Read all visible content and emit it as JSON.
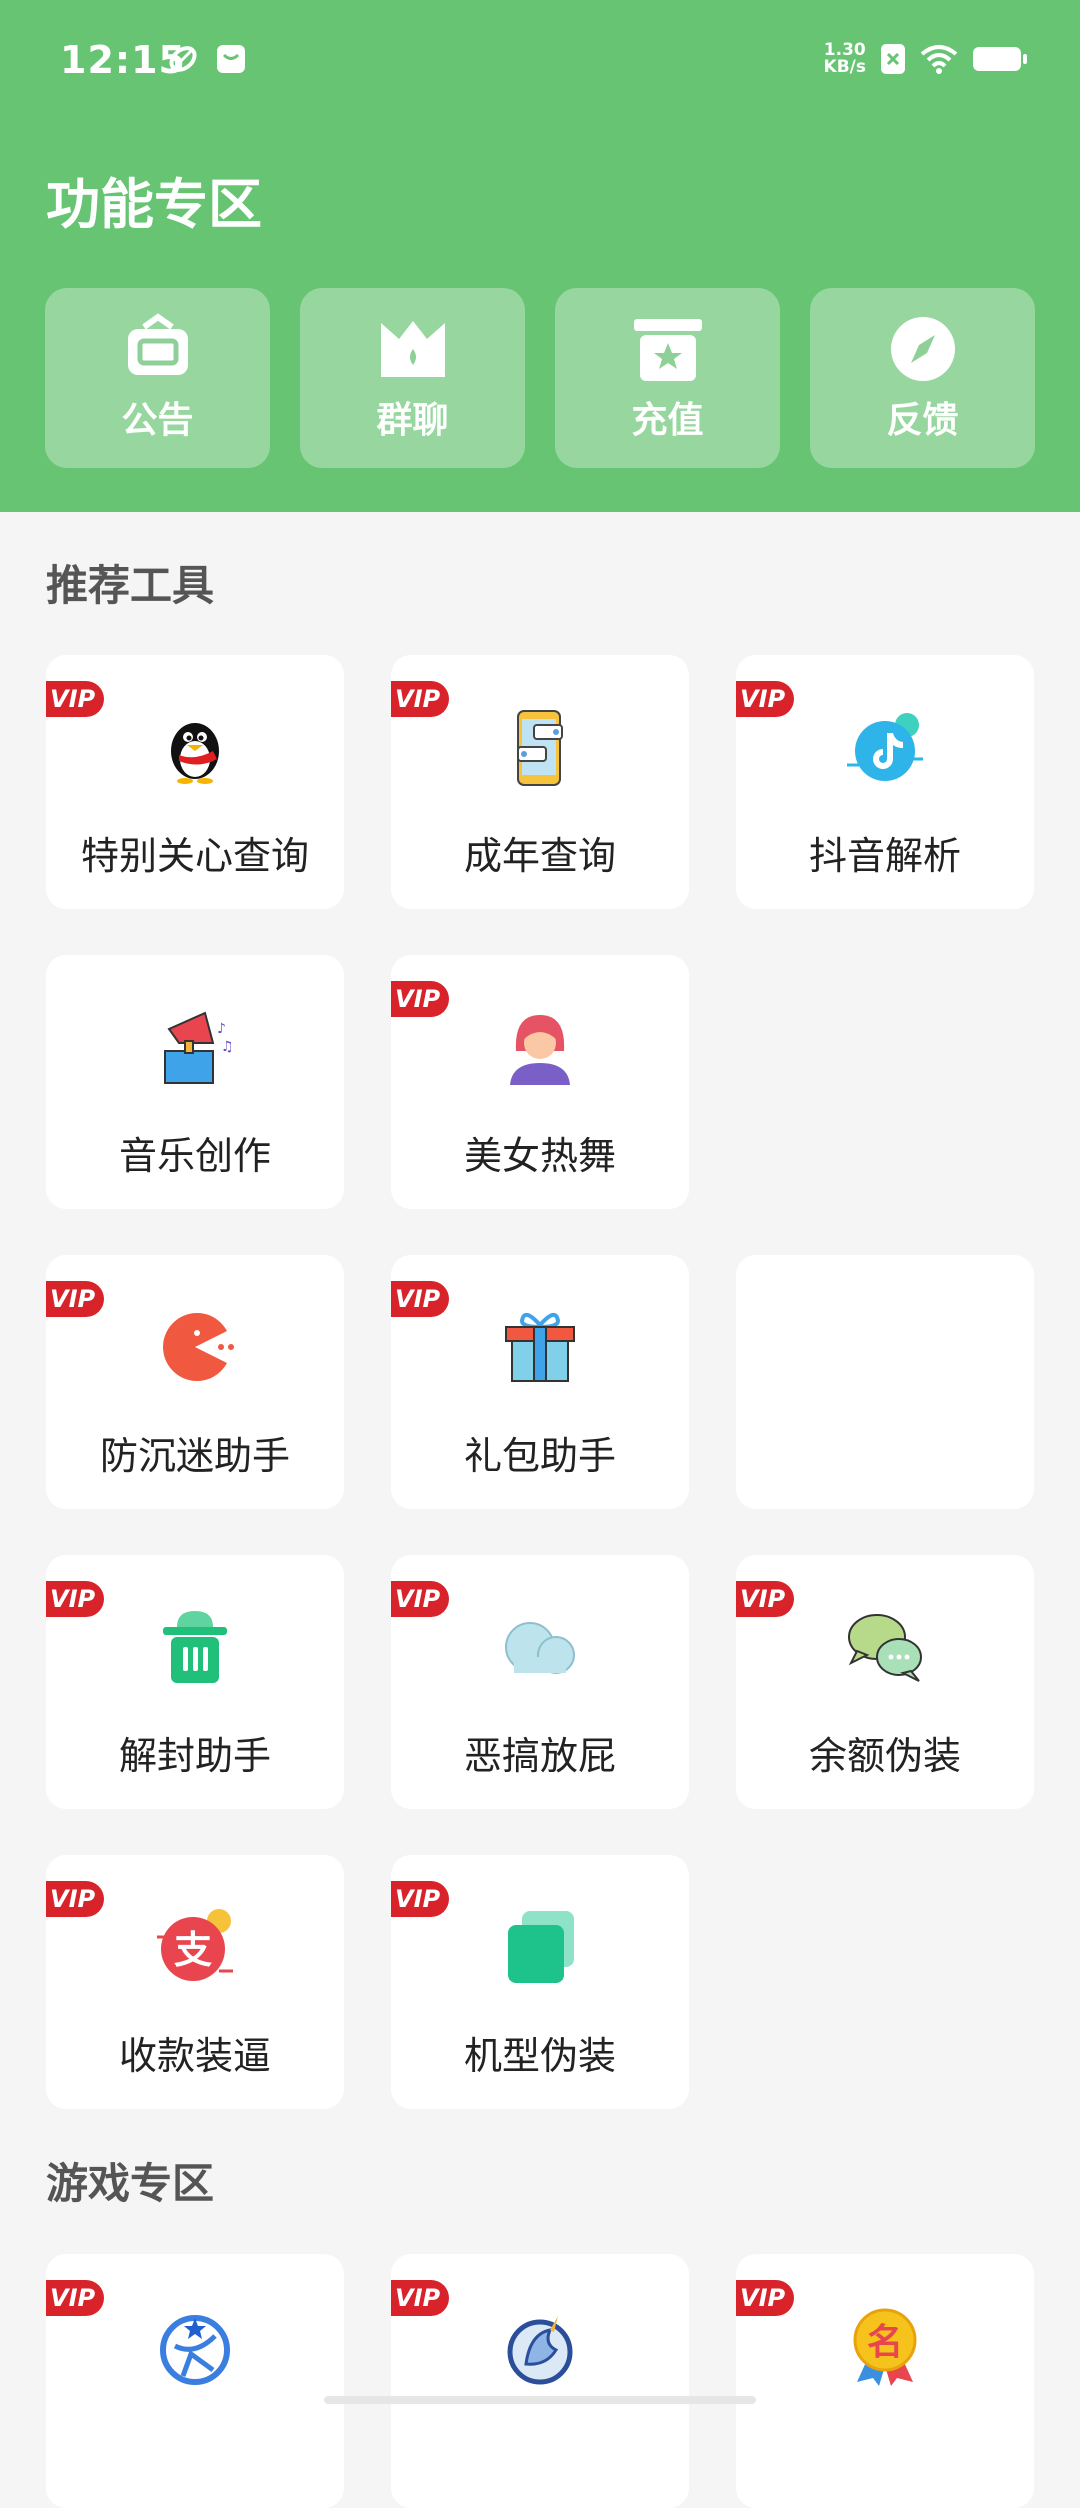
{
  "status": {
    "time": "12:15",
    "net_speed_value": "1.30",
    "net_speed_unit": "KB/s",
    "left_icons": [
      "leaf-notification-icon",
      "message-notification-icon"
    ],
    "right_icons": [
      "sim-off-icon",
      "wifi-icon",
      "battery-icon"
    ]
  },
  "header": {
    "title": "功能专区",
    "quick_actions": [
      {
        "label": "公告",
        "icon": "notice-icon"
      },
      {
        "label": "群聊",
        "icon": "crown-icon"
      },
      {
        "label": "充值",
        "icon": "gift-box-icon"
      },
      {
        "label": "反馈",
        "icon": "compass-icon"
      }
    ]
  },
  "sections": {
    "tools_title": "推荐工具",
    "games_title": "游戏专区"
  },
  "vip_label": "VIP",
  "tools": [
    {
      "label": "特别关心查询",
      "vip": true,
      "icon": "penguin-icon"
    },
    {
      "label": "成年查询",
      "vip": true,
      "icon": "phone-chat-icon"
    },
    {
      "label": "抖音解析",
      "vip": true,
      "icon": "tiktok-icon"
    },
    {
      "label": "音乐创作",
      "vip": false,
      "icon": "gramophone-icon"
    },
    {
      "label": "美女热舞",
      "vip": true,
      "icon": "girl-avatar-icon"
    },
    {
      "label": "防沉迷助手",
      "vip": true,
      "icon": "pacman-icon"
    },
    {
      "label": "礼包助手",
      "vip": true,
      "icon": "gift-icon"
    },
    {
      "label": "",
      "vip": false,
      "icon": ""
    },
    {
      "label": "解封助手",
      "vip": true,
      "icon": "trash-can-icon"
    },
    {
      "label": "恶搞放屁",
      "vip": true,
      "icon": "cloud-icon"
    },
    {
      "label": "余额伪装",
      "vip": true,
      "icon": "chat-bubbles-icon"
    },
    {
      "label": "收款装逼",
      "vip": true,
      "icon": "alipay-icon"
    },
    {
      "label": "机型伪装",
      "vip": true,
      "icon": "layers-icon"
    }
  ],
  "games": [
    {
      "label": "",
      "vip": true,
      "icon": "globe-star-icon"
    },
    {
      "label": "",
      "vip": true,
      "icon": "dragon-icon"
    },
    {
      "label": "",
      "vip": true,
      "icon": "medal-icon",
      "medal_text": "名"
    }
  ]
}
